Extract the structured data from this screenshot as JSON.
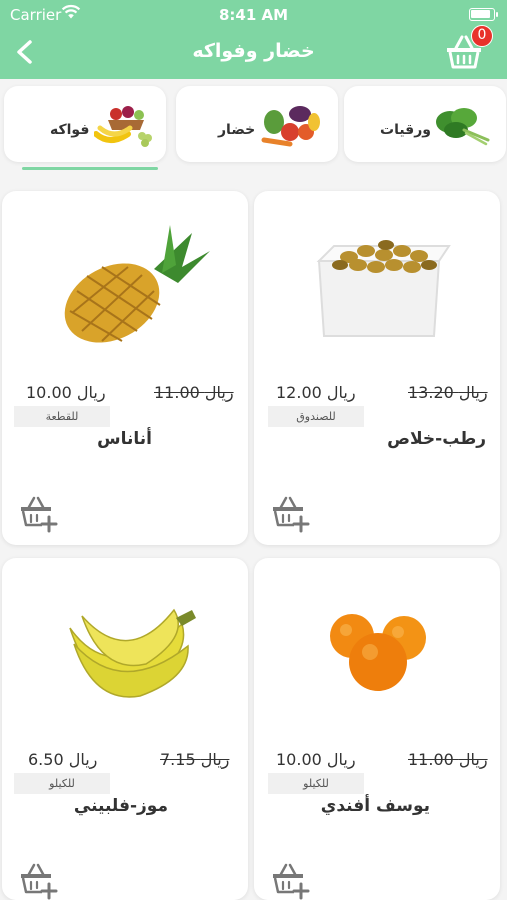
{
  "status": {
    "carrier": "Carrier",
    "time": "8:41 AM"
  },
  "header": {
    "title": "خضار وفواكه",
    "cart_count": "0"
  },
  "tabs": [
    {
      "label": "ورقيات",
      "icon": "leafy-greens-image"
    },
    {
      "label": "خضار",
      "icon": "vegetables-image"
    },
    {
      "label": "فواكه",
      "icon": "fruits-image"
    }
  ],
  "products": [
    {
      "name": "رطب-خلاص",
      "old_price": "13.20 ريال",
      "price": "12.00 ريال",
      "unit": "للصندوق",
      "image": "dates-box-image"
    },
    {
      "name": "أناناس",
      "old_price": "11.00 ريال",
      "price": "10.00 ريال",
      "unit": "للقطعة",
      "image": "pineapple-image"
    },
    {
      "name": "يوسف أفندي",
      "old_price": "11.00 ريال",
      "price": "10.00 ريال",
      "unit": "للكيلو",
      "image": "tangerine-image"
    },
    {
      "name": "موز-فلبيني",
      "old_price": "7.15 ريال",
      "price": "6.50 ريال",
      "unit": "للكيلو",
      "image": "banana-image"
    }
  ],
  "colors": {
    "header": "#7fd6a3",
    "badge": "#e8322b",
    "background": "#f4f4f4"
  }
}
